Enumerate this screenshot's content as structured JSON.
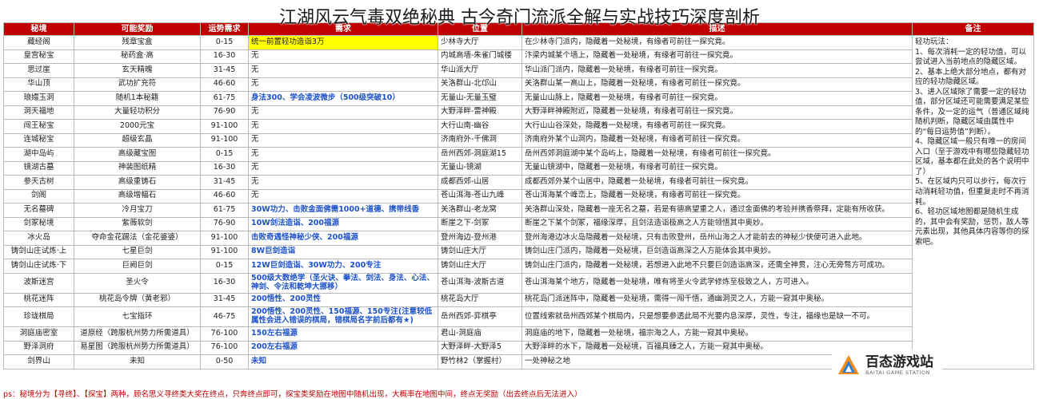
{
  "title": "江湖风云气毒双绝秘典 古今奇门流派全解与实战技巧深度剖析",
  "headers": [
    "秘境",
    "可能奖励",
    "运势需求",
    "需求",
    "位置",
    "描述",
    "备注"
  ],
  "rows": [
    {
      "name": "藏经阁",
      "reward": "残章宝盒",
      "luck": "0-15",
      "req": "统一前置轻功造诣3万",
      "loc": "少林寺大厅",
      "desc": "在少林寺门派内，隐藏着一处秘境，有缘者可前往一探究竟。",
      "hl": true
    },
    {
      "name": "皇宫秘宝",
      "reward": "秘药盒·高",
      "luck": "16-30",
      "req": "无",
      "loc": "内城高墙-朱雀门城楼",
      "desc": "汴梁内城某个墙上，隐藏着一处秘境，有缘者可前往一探究竟。"
    },
    {
      "name": "思过崖",
      "reward": "玄天精魄",
      "luck": "31-45",
      "req": "无",
      "loc": "华山派大厅",
      "desc": "华山派门派内，隐藏着一处秘境，有缘者可前往一探究竟。"
    },
    {
      "name": "华山顶",
      "reward": "武功扩充符",
      "luck": "46-60",
      "req": "无",
      "loc": "关洛群山-北邙山",
      "desc": "关洛群山某一高山上，隐藏着一处秘境，有缘者可前往一探究竟。"
    },
    {
      "name": "琅嬛玉洞",
      "reward": "随机1本秘籍",
      "luck": "61-75",
      "req": "身法300、学会凌波微步（500级突破10）",
      "loc": "无量山-无量玉璧",
      "desc": "无量山山脉上，隐藏着一处秘境，有缘者可前往一探究竟。",
      "blue": true
    },
    {
      "name": "洞天福地",
      "reward": "大量轻功积分",
      "luck": "76-90",
      "req": "无",
      "loc": "大野泽畔-雷神殿",
      "desc": "大野泽畔神殿附近，隐藏着一处秘境，有缘者可前往一探究竟。"
    },
    {
      "name": "闯王秘宝",
      "reward": "2000元宝",
      "luck": "91-100",
      "req": "无",
      "loc": "大行山南-幽谷",
      "desc": "大行山山谷深处，隐藏着一处秘境，有缘者可前往一探究竟。"
    },
    {
      "name": "连城秘宝",
      "reward": "超级玄晶",
      "luck": "91-100",
      "req": "无",
      "loc": "济南府外-千佛洞",
      "desc": "济南府外某个山洞内，隐藏着一处秘境，有缘者可前往一探究竟。"
    },
    {
      "name": "湖中岛屿",
      "reward": "高级藏宝图",
      "luck": "0-15",
      "req": "无",
      "loc": "岳州西郊-洞庭湖15",
      "desc": "岳州西郊洞庭湖中某个岛屿上，隐藏着一处秘境，有缘者可前往一探究竟。"
    },
    {
      "name": "镜湖古墓",
      "reward": "神装图纸精",
      "luck": "16-30",
      "req": "无",
      "loc": "无量山-镜湖",
      "desc": "无量山镜湖中，隐藏着一处秘境，有缘者可前往一探究竟。"
    },
    {
      "name": "参天古树",
      "reward": "高级重铸石",
      "luck": "31-45",
      "req": "无",
      "loc": "成都西郊-山居",
      "desc": "成都西郊外某个山居中，隐藏着一处秘境，有缘者可前往一探究竟。"
    },
    {
      "name": "剑阁",
      "reward": "高级增幅石",
      "luck": "46-60",
      "req": "无",
      "loc": "苍山洱海-苍山九峰",
      "desc": "苍山洱海某个峰峦上，隐藏着一处秘境，有缘者可前往一探究竟。"
    },
    {
      "name": "无名墓碑",
      "reward": "冷月宝刀",
      "luck": "61-75",
      "req": "30W功力、击败金面佛需1000+道德、携带线香",
      "loc": "关洛群山-老龙窝",
      "desc": "关洛群山深处，隐藏着一座无名之墓，若是有德高望重之人，通过金面佛的考验并携香祭拜，定能有所收获。",
      "blue": true
    },
    {
      "name": "剑冢秘境",
      "reward": "紫薇软剑",
      "luck": "76-90",
      "req": "10W剑法造诣、200福源",
      "loc": "断崖之下-剑冢",
      "desc": "断崖之下某个剑冢，福缘深厚，且剑法造诣极高之人方能领悟其中奥妙。",
      "blue": true
    },
    {
      "name": "冰火岛",
      "reward": "夺命金花踢法（金花婆婆）",
      "luck": "91-100",
      "req": "击败奇遇怪神秘少侠、200福源",
      "loc": "登州海边-登州港",
      "desc": "登州海港边冰火岛隐藏着一处秘境，只有击败登州，岳州山海之人才能前去的神秘少侠便可进入此地。",
      "blue": true
    },
    {
      "name": "铸剑山庄试炼·上",
      "reward": "七星巨剑",
      "luck": "91-100",
      "req": "8W巨剑造诣",
      "loc": "铸剑山庄大厅",
      "desc": "铸剑山庄门派内，隐藏着一处秘境，巨剑造诣高深之人方能体会其中奥妙。",
      "blue": true
    },
    {
      "name": "铸剑山庄试炼·下",
      "reward": "巨阙巨剑",
      "luck": "0-15",
      "req": "12W巨剑造诣、30W功力、200专注",
      "loc": "铸剑山庄大厅",
      "desc": "铸剑山庄门派内，隐藏着一处秘境，若想进入此地不只要巨剑造诣高深，还需全神贯，注心无旁骛方可成功。",
      "blue": true
    },
    {
      "name": "波斯迷宫",
      "reward": "圣火令",
      "luck": "16-30",
      "req": "500级大数绝学（圣火诀、拳法、剑法、身法、心法、神剑、令法和乾坤大挪移）",
      "loc": "苍山洱海-波斯古道",
      "desc": "苍山洱海某个地方，隐藏着一处秘境，唯有将圣火令武学修炼至极致之人，方可进入。",
      "blue": true,
      "tall": true
    },
    {
      "name": "桃花迷阵",
      "reward": "桃花岛令牌（黄老邪）",
      "luck": "31-45",
      "req": "200悟性、200灵性",
      "loc": "桃花岛大厅",
      "desc": "桃花岛门派迷阵中，隐藏着一处秘境，需得一闯千悟，通幽洞灵之人，方能一窥其中奥秘。",
      "blue": true
    },
    {
      "name": "珍珑棋局",
      "reward": "七宝指环",
      "luck": "46-75",
      "req": "200悟性、200灵性、150福源、150专注(注意较低属性会进入错误的棋局，错棋局名字前后都有★)",
      "loc": "岳州西郊-弈棋亭",
      "desc": "位置线索就岳州西郊某个棋局内，只是想要参透此局不光要内息深厚，灵性，专注，福缘也是缺一不可。",
      "blue": true,
      "tall": true
    },
    {
      "name": "洞庭庙密室",
      "reward": "道原经（跨服杭州势力所需道具）",
      "luck": "76-100",
      "req": "150左右福源",
      "loc": "君山-洞庭庙",
      "desc": "洞庭庙的地下，隐藏着一处秘境，福宗海之人，方能一窥其中奥秘。",
      "blue": true
    },
    {
      "name": "野泽洞府",
      "reward": "易星图（跨服杭州势力所需道具）",
      "luck": "76-100",
      "req": "200左右福源",
      "loc": "大野泽畔-大野泽5",
      "desc": "大野泽畔的水下，隐藏着一处秘境，百福具臻之人，方能一窥其中奥秘。",
      "blue": true
    },
    {
      "name": "剑界山",
      "reward": "未知",
      "luck": "0-50",
      "req": "未知",
      "loc": "野竹林2（掌握村）",
      "desc": "一处神秘之地",
      "blue": true
    }
  ],
  "note": "轻功玩法：\n1、每次消耗一定的轻功值，可以尝试进入当前地点的隐藏区域。\n2、基本上绝大部分地点，都有对应的轻功隐藏区域。\n3、进入区域除了需要一定的轻功值，部分区域还可能需要满足某些条件，及一定的运气（普通区域纯随机判断，隐藏区域由属性中的“每日运势值”判断）。\n4、隐藏区域一般只有唯一的房间入口（至于游戏中有哪些隐藏轻功区域，基本都在此处的各个说明中了）\n5、在区域内只可以步行，每次行动消耗轻功值，但重复走时不再消耗。\n6、轻功区域地图都是随机生成的，其中会有奖励，惩罚，敌人等元素出现，其他具体内容等你的探索吧。",
  "footnote": "ps：秘境分为【寻终】、【探宝】两种，顾名思义寻终类大奖在终点，只奔终点即可，探宝类奖励在地图中随机出现，大概率在地图中间，终点无奖励（出去终点后无法进入）",
  "watermark": {
    "name": "百态游戏站",
    "sub": "BAITAI GAME STATION"
  },
  "colors": {
    "header": "#c00000",
    "highlight": "#ffff00",
    "blue_text": "#1d52c9",
    "footnote": "#c00000"
  }
}
